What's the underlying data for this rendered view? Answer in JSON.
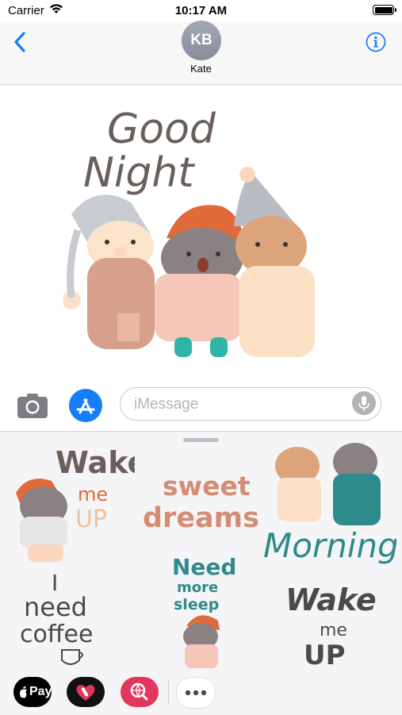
{
  "status_bar": {
    "carrier": "Carrier",
    "time": "10:17 AM",
    "battery_level": 1.0
  },
  "nav": {
    "contact_initials": "KB",
    "contact_name": "Kate"
  },
  "conversation": {
    "sticker": {
      "line1": "Good",
      "line2": "Night"
    }
  },
  "composer": {
    "placeholder": "iMessage"
  },
  "drawer": {
    "stickers": [
      {
        "line1": "Wake",
        "line2": "me",
        "line3": "UP"
      },
      {
        "line1": "sweet",
        "line2": "dreams"
      },
      {
        "line1": "Morning"
      },
      {
        "line1": "I",
        "line2": "need",
        "line3": "coffee"
      },
      {
        "line1": "Need",
        "line2": "more",
        "line3": "sleep"
      },
      {
        "line1": "Wake",
        "line2": "me",
        "line3": "UP"
      }
    ]
  },
  "dock": {
    "apple_pay_label": "Pay",
    "icons": [
      "apple-pay-icon",
      "digital-touch-icon",
      "image-search-icon",
      "more-apps-icon"
    ]
  },
  "colors": {
    "accent": "#157efb",
    "teal": "#2e8b8b",
    "brown": "#6b5f5c",
    "orange": "#e06a3a",
    "pink": "#e2375d"
  }
}
